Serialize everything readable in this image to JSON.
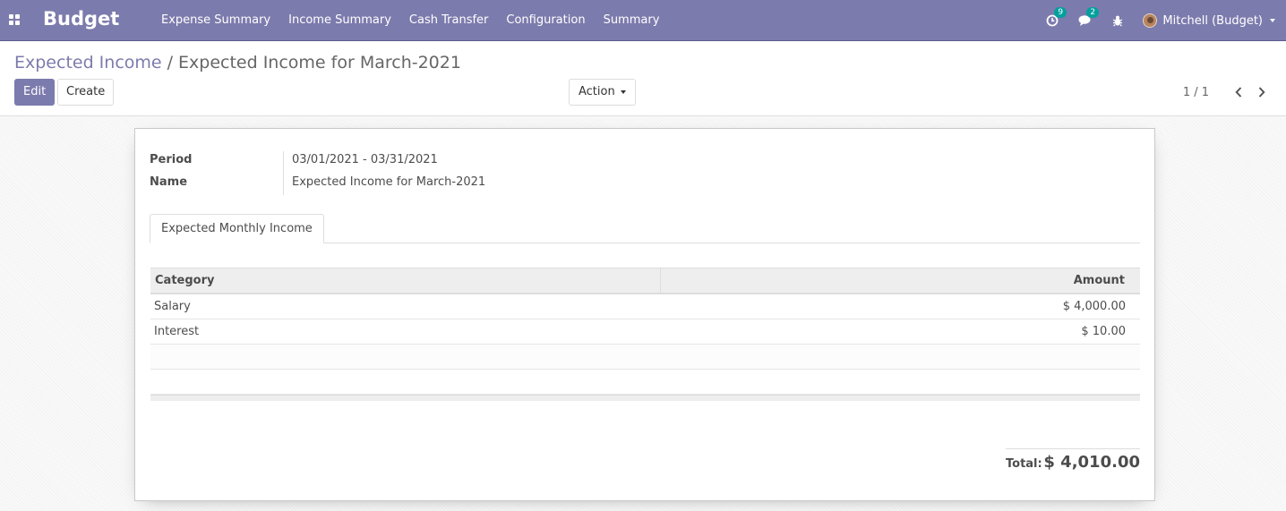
{
  "navbar": {
    "apps_icon": "apps-grid-icon",
    "brand": "Budget",
    "menu": [
      {
        "label": "Expense Summary"
      },
      {
        "label": "Income Summary"
      },
      {
        "label": "Cash Transfer"
      },
      {
        "label": "Configuration"
      },
      {
        "label": "Summary"
      }
    ],
    "activity_badge": "9",
    "messages_badge": "2",
    "user_name": "Mitchell (Budget)",
    "colors": {
      "navbar": "#7c7bad",
      "badge": "#00a09d"
    }
  },
  "control": {
    "breadcrumb_parent": "Expected Income",
    "breadcrumb_separator": "/",
    "breadcrumb_current": "Expected Income for March-2021",
    "edit_label": "Edit",
    "create_label": "Create",
    "action_label": "Action",
    "pager_value": "1 / 1"
  },
  "form": {
    "period_label": "Period",
    "period_value": "03/01/2021 - 03/31/2021",
    "name_label": "Name",
    "name_value": "Expected Income for March-2021",
    "tab_label": "Expected Monthly Income",
    "columns": {
      "category": "Category",
      "amount": "Amount"
    },
    "rows": [
      {
        "category": "Salary",
        "amount": "$ 4,000.00"
      },
      {
        "category": "Interest",
        "amount": "$ 10.00"
      }
    ],
    "total_label": "Total:",
    "total_value": "$ 4,010.00"
  }
}
